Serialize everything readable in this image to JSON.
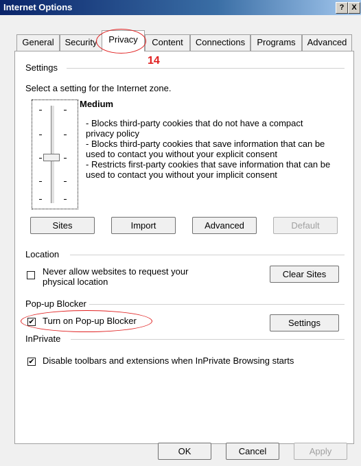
{
  "window": {
    "title": "Internet Options",
    "help_label": "?",
    "close_label": "X"
  },
  "tabs": [
    {
      "label": "General"
    },
    {
      "label": "Security"
    },
    {
      "label": "Privacy"
    },
    {
      "label": "Content"
    },
    {
      "label": "Connections"
    },
    {
      "label": "Programs"
    },
    {
      "label": "Advanced"
    }
  ],
  "annotation": {
    "step_number": "14"
  },
  "settings": {
    "group_label": "Settings",
    "zone_text": "Select a setting for the Internet zone.",
    "level": "Medium",
    "description": "- Blocks third-party cookies that do not have a compact privacy policy\n- Blocks third-party cookies that save information that can be used to contact you without your explicit consent\n- Restricts first-party cookies that save information that can be used to contact you without your implicit consent",
    "buttons": {
      "sites": "Sites",
      "import": "Import",
      "advanced": "Advanced",
      "default": "Default"
    }
  },
  "location": {
    "group_label": "Location",
    "checkbox_label": "Never allow websites to request your physical location",
    "checked": false,
    "clear_sites": "Clear Sites"
  },
  "popup": {
    "group_label": "Pop-up Blocker",
    "checkbox_label": "Turn on Pop-up Blocker",
    "checked": true,
    "settings_button": "Settings"
  },
  "inprivate": {
    "group_label": "InPrivate",
    "checkbox_label": "Disable toolbars and extensions when InPrivate Browsing starts",
    "checked": true
  },
  "footer": {
    "ok": "OK",
    "cancel": "Cancel",
    "apply": "Apply"
  },
  "colors": {
    "highlight": "#e02020",
    "title_bar": "#0a246a"
  }
}
